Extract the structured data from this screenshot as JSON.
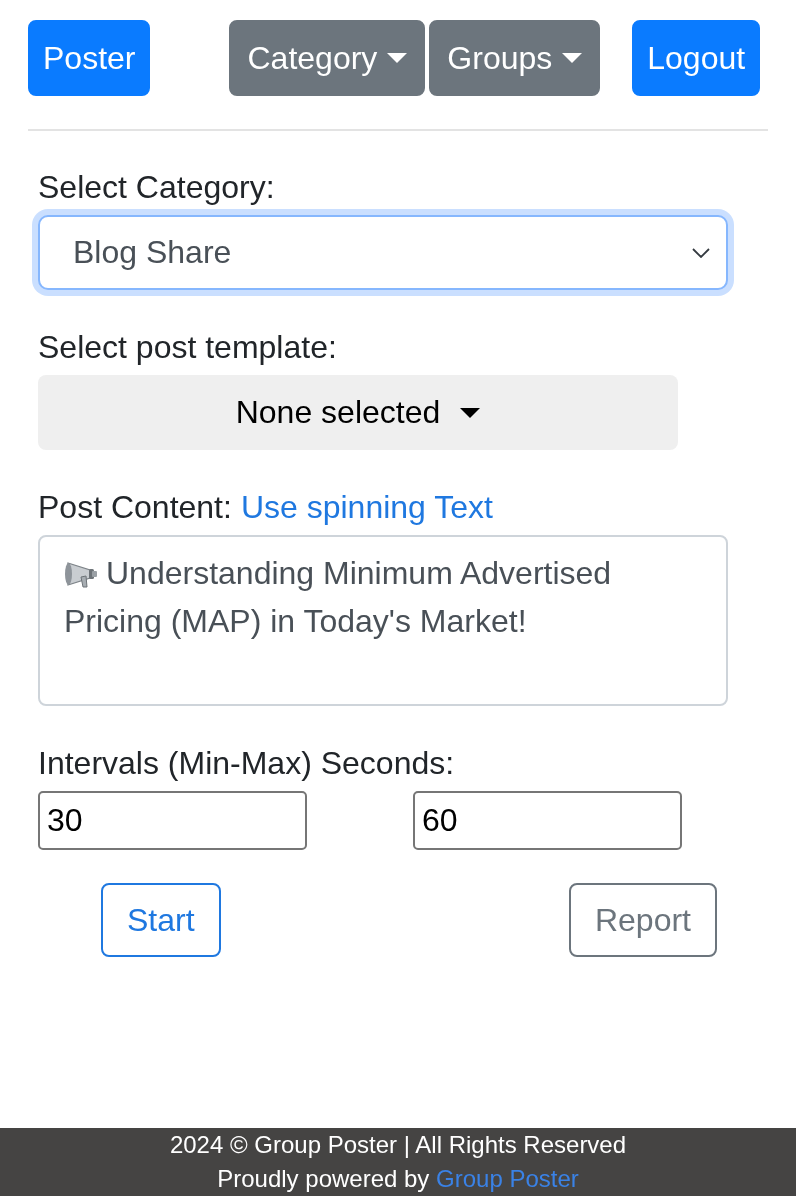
{
  "navbar": {
    "items": [
      {
        "label": "Poster",
        "kind": "primary"
      },
      {
        "label": "Category",
        "kind": "dropdown"
      },
      {
        "label": "Groups",
        "kind": "dropdown"
      },
      {
        "label": "Logout",
        "kind": "primary"
      }
    ]
  },
  "form": {
    "category": {
      "label": "Select Category:",
      "value": "Blog Share",
      "focused": true
    },
    "template": {
      "label": "Select post template:",
      "value": "None selected"
    },
    "content": {
      "label": "Post Content:",
      "link": "Use spinning Text",
      "value": "Understanding Minimum Advertised Pricing (MAP) in Today's Market!"
    },
    "intervals": {
      "label": "Intervals (Min-Max) Seconds:",
      "min": "30",
      "max": "60"
    },
    "buttons": [
      {
        "label": "Start",
        "kind": "primary"
      },
      {
        "label": "Report",
        "kind": "secondary"
      }
    ]
  },
  "footer": {
    "copyright": "2024 © Group Poster | All Rights Reserved",
    "powered_by": "Proudly powered by",
    "link": "Group Poster"
  }
}
